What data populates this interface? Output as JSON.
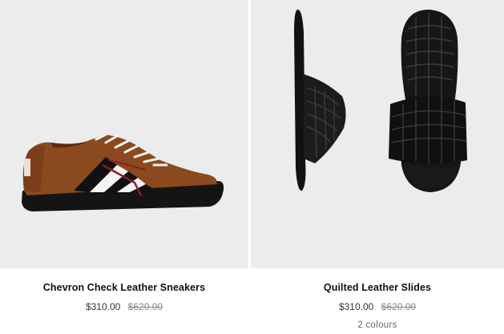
{
  "products": [
    {
      "name": "Chevron Check Leather Sneakers",
      "price": "$310.00",
      "original_price": "$620.00",
      "image_icon": "sneaker-image"
    },
    {
      "name": "Quilted Leather Slides",
      "price": "$310.00",
      "original_price": "$620.00",
      "colours": "2 colours",
      "image_icon": "slide-image"
    }
  ],
  "colors": {
    "image_background": "#ececec",
    "sneaker_leather": "#8a4a1e",
    "sole": "#141414"
  }
}
